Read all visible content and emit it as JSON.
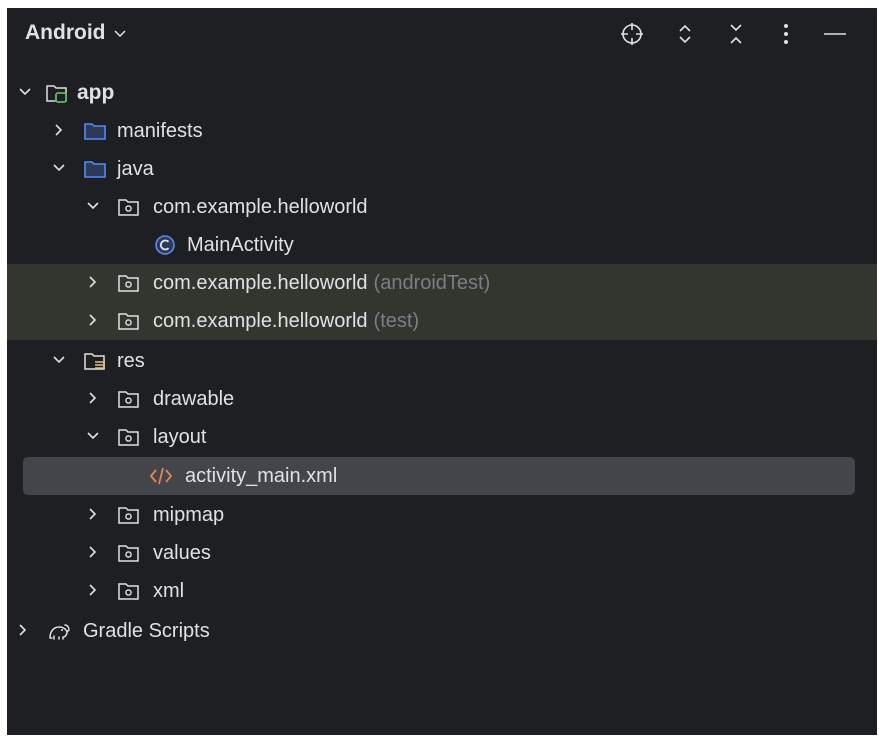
{
  "header": {
    "title": "Android",
    "icons": [
      "crosshair-icon",
      "expand-all-icon",
      "collapse-all-icon",
      "more-options-icon",
      "minimize-icon"
    ]
  },
  "tree": {
    "app": "app",
    "manifests": "manifests",
    "java": "java",
    "pkg_main": "com.example.helloworld",
    "main_activity": "MainActivity",
    "pkg_android_test": "com.example.helloworld",
    "pkg_android_test_suffix": "(androidTest)",
    "pkg_test": "com.example.helloworld",
    "pkg_test_suffix": "(test)",
    "res": "res",
    "drawable": "drawable",
    "layout": "layout",
    "activity_main": "activity_main.xml",
    "mipmap": "mipmap",
    "values": "values",
    "xml": "xml",
    "gradle_scripts": "Gradle Scripts"
  },
  "colors": {
    "background": "#1e1f22",
    "text": "#dfe1e5",
    "muted_text": "#7a7e85",
    "folder_blue": "#548af7",
    "module_green": "#5fb865",
    "xml_orange": "#e08855",
    "row_highlight": "#33362f",
    "row_selected": "#43454a"
  }
}
